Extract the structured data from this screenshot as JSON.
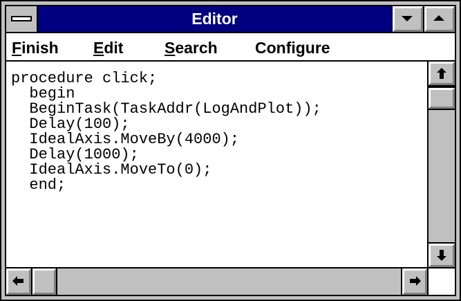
{
  "window": {
    "title": "Editor"
  },
  "menu": {
    "finish_first": "F",
    "finish_rest": "inish",
    "edit_first": "E",
    "edit_rest": "dit",
    "search_first": "S",
    "search_rest": "earch",
    "configure": "Configure"
  },
  "editor": {
    "lines": [
      "procedure click;",
      "  begin",
      "  BeginTask(TaskAddr(LogAndPlot));",
      "  Delay(100);",
      "  IdealAxis.MoveBy(4000);",
      "  Delay(1000);",
      "  IdealAxis.MoveTo(0);",
      "  end;"
    ]
  },
  "colors": {
    "titlebar": "#000080",
    "chrome": "#c0c0c0"
  }
}
